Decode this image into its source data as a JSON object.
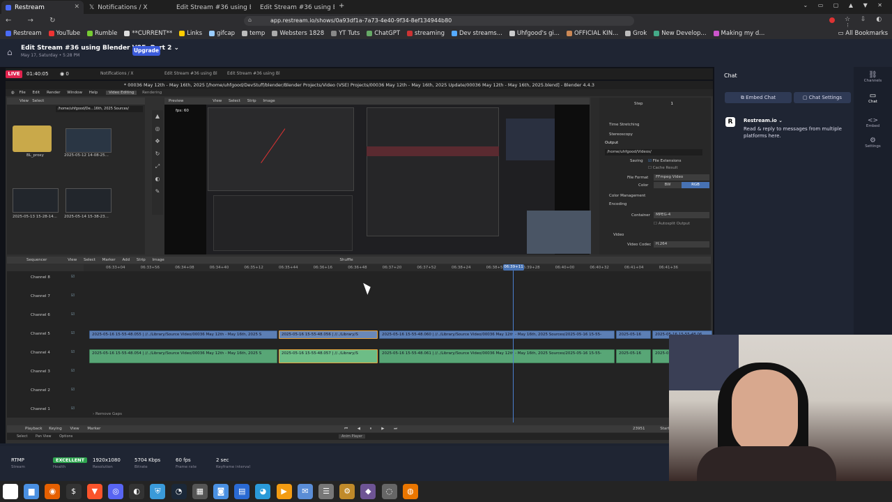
{
  "browser": {
    "tabs": [
      "Restream",
      "Notifications / X",
      "Edit Stream #36 using Bl",
      "Edit Stream #36 using Bl"
    ],
    "url": "app.restream.io/shows/0a93df1a-7a73-4e40-9f34-8ef134944b80",
    "bookmarks": [
      "Restream",
      "YouTube",
      "Rumble",
      "**CURRENT**",
      "Links",
      "gifcap",
      "temp",
      "Websters 1828",
      "YT Tuts",
      "ChatGPT",
      "streaming",
      "Dev streams...",
      "Uhfgood's gi...",
      "OFFICIAL KIN...",
      "Grok",
      "New Develop...",
      "Making my d..."
    ],
    "all_bookmarks": "All Bookmarks"
  },
  "restream": {
    "stream_title": "Edit Stream #36 using Blender VSE. Part 2",
    "stream_date": "May 17, Saturday • 5:28 PM",
    "upgrade_label": "Upgrade",
    "live_badge": "LIVE",
    "timer": "01:40:05",
    "viewers": "0"
  },
  "chat": {
    "title": "Chat",
    "embed_label": "Embed Chat",
    "settings_label": "Chat Settings",
    "sender": "Restream.io",
    "message": "Read & reply to messages from multiple platforms here.",
    "rail": [
      "Channels",
      "Chat",
      "Embed",
      "Settings"
    ]
  },
  "stats": [
    {
      "value": "RTMP",
      "label": "Stream"
    },
    {
      "value": "EXCELLENT",
      "label": "Health"
    },
    {
      "value": "1920x1080",
      "label": "Resolution"
    },
    {
      "value": "5704 Kbps",
      "label": "Bitrate"
    },
    {
      "value": "60 fps",
      "label": "Frame rate"
    },
    {
      "value": "2 sec",
      "label": "Keyframe interval"
    }
  ],
  "blender": {
    "title": "* 00036 May 12th - May 16th, 2025 [/home/uhfgood/DevStuff/blender/Blender Projects/Video (VSE) Projects/00036 May 12th - May 16th, 2025 Update/00036 May 12th - May 16th, 2025.blend] - Blender 4.4.3",
    "menus": [
      "File",
      "Edit",
      "Render",
      "Window",
      "Help",
      "Video Editing",
      "Rendering"
    ],
    "file_path": "/home/uhfgood/De...16th, 2025 Sources/",
    "files": [
      "BL_proxy",
      "2025-05-12 14-08-25...",
      "2025-05-13 15-28-14...",
      "2025-05-14 15-38-23..."
    ],
    "preview_label": "Preview",
    "preview_menus": [
      "View",
      "Select",
      "Strip",
      "Image"
    ],
    "fps": "fps: 60",
    "props": {
      "time_stretching": "Time Stretching",
      "stereoscopy": "Stereoscopy",
      "output": "Output",
      "path": "/home/uhfgood/Videos/",
      "saving": "Saving",
      "file_extensions": "File Extensions",
      "cache_result": "Cache Result",
      "file_format_label": "File Format",
      "file_format": "FFmpeg Video",
      "color_label": "Color",
      "bw": "BW",
      "rgb": "RGB",
      "color_management": "Color Management",
      "encoding": "Encoding",
      "container_label": "Container",
      "container": "MPEG-4",
      "autosplit": "Autosplit Output",
      "video": "Video",
      "codec_label": "Video Codec",
      "codec": "H.264",
      "step_label": "Step",
      "step": "1"
    },
    "sequencer_label": "Sequencer",
    "seq_menus": [
      "View",
      "Select",
      "Marker",
      "Add",
      "Strip",
      "Image"
    ],
    "shuffle": "Shuffle",
    "time_ticks": [
      "06:33+04",
      "06:33+56",
      "06:34+08",
      "06:34+40",
      "06:35+12",
      "06:35+44",
      "06:36+16",
      "06:36+48",
      "06:37+20",
      "06:37+52",
      "06:38+24",
      "06:38+56",
      "06:39+28",
      "06:40+00",
      "06:40+32",
      "06:41+04",
      "06:41+36"
    ],
    "playhead": "06:39+11",
    "channels": [
      "Channel 8",
      "Channel 7",
      "Channel 6",
      "Channel 5",
      "Channel 4",
      "Channel 3",
      "Channel 2",
      "Channel 1"
    ],
    "video_strips": [
      "2025-05-16 15-55-48.055 | //../Library/Source Video/00036 May 12th - May 16th, 2025 S",
      "2025-05-16 15-55-48.056 | //../Library/S",
      "2025-05-16 15-55-48.060 | //../Library/Source Video/00036 May 12th - May 16th, 2025 Sources/2025-05-16 15-55-",
      "2025-05-16",
      "2025-05-16 15-55-48.06"
    ],
    "audio_strips": [
      "2025-05-16 15-55-48.054 | //../Library/Source Video/00036 May 12th - May 16th, 2025 S",
      "2025-05-16 15-55-48.057 | //../Library/S",
      "2025-05-16 15-55-48.061 | //../Library/Source Video/00036 May 12th - May 16th, 2025 Sources/2025-05-16 15-55-",
      "2025-05-16",
      "2025-05"
    ],
    "remove_gaps": "Remove Gaps",
    "playback_menus": [
      "Playback",
      "Keying",
      "View",
      "Marker"
    ],
    "frame": "23951",
    "start": "Start",
    "status": [
      "Select",
      "Pan View",
      "Options"
    ],
    "anim_player": "Anim Player"
  }
}
